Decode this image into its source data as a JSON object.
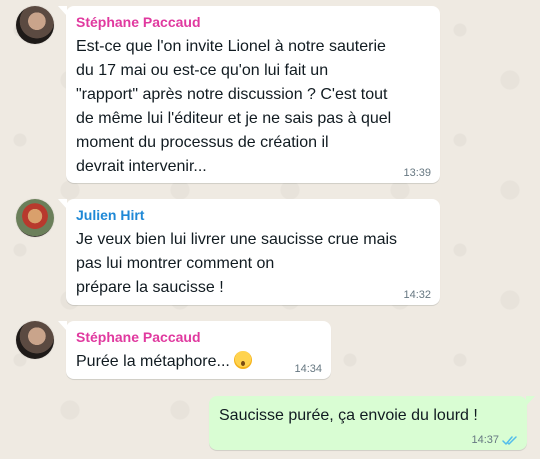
{
  "colors": {
    "sender_stephane": "#e0399f",
    "sender_julien": "#1e88d6",
    "read_ticks": "#53bdeb"
  },
  "messages": [
    {
      "sender": "Stéphane Paccaud",
      "text": "Est-ce que l'on invite Lionel à notre sauterie\ndu 17 mai ou est-ce qu'on lui fait un\n\"rapport\" après notre discussion ? C'est tout\nde même lui l'éditeur et je ne sais pas à quel\nmoment du processus de création il\ndevrait intervenir...",
      "time": "13:39"
    },
    {
      "sender": "Julien Hirt",
      "text": "Je veux bien lui livrer une saucisse crue mais\npas lui montrer comment on\nprépare la saucisse !",
      "time": "14:32"
    },
    {
      "sender": "Stéphane Paccaud",
      "text": "Purée la métaphore...",
      "emoji": "flushed-face",
      "time": "14:34"
    },
    {
      "text": "Saucisse purée, ça envoie du lourd !",
      "time": "14:37",
      "status": "read"
    }
  ]
}
